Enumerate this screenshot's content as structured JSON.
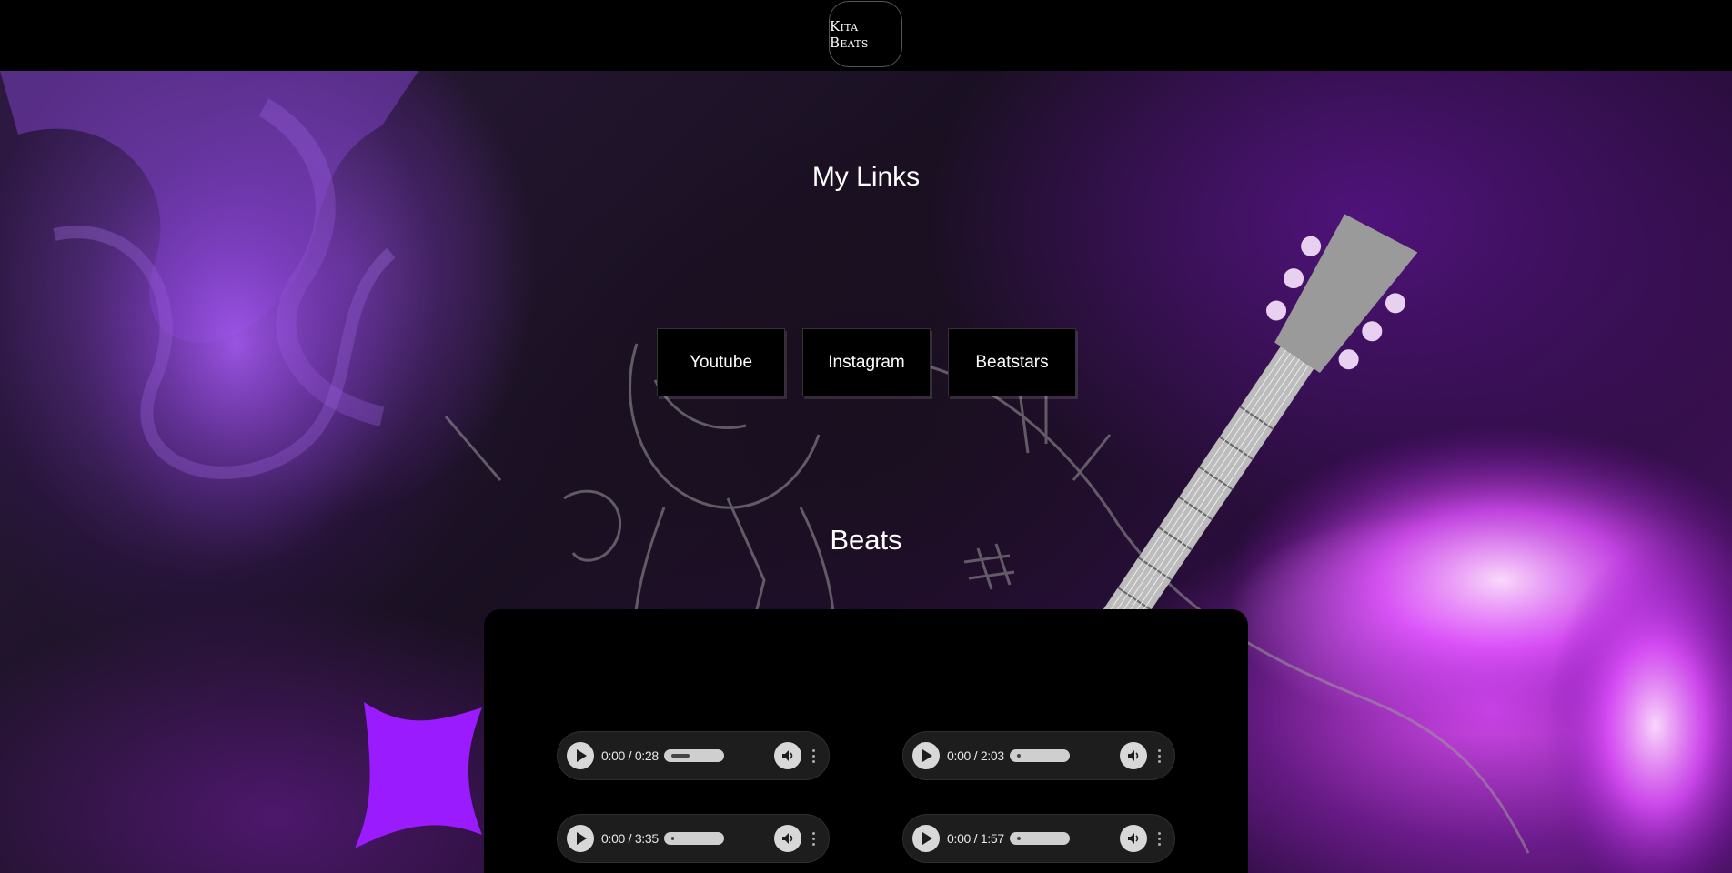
{
  "header": {
    "logo_text": "Kita Beats"
  },
  "links_section": {
    "title": "My Links",
    "buttons": [
      "Youtube",
      "Instagram",
      "Beatstars"
    ]
  },
  "beats_section": {
    "title": "Beats",
    "players": [
      {
        "time": "0:00 / 0:28",
        "progress": 0
      },
      {
        "time": "0:00 / 2:03",
        "progress": 0
      },
      {
        "time": "0:00 / 3:35",
        "progress": 0
      },
      {
        "time": "0:00 / 1:57",
        "progress": 0
      }
    ]
  },
  "colors": {
    "accent_purple": "#9b1bff",
    "background": "#000000",
    "panel": "#000000"
  },
  "icons": [
    "play-icon",
    "volume-icon",
    "more-vert-icon"
  ]
}
